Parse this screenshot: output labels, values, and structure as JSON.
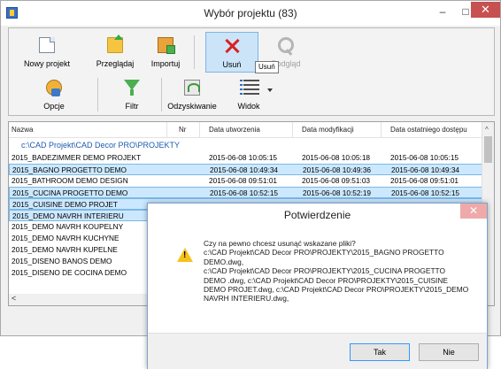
{
  "window": {
    "title": "Wybór projektu (83)",
    "minimize": "–",
    "maximize": "□",
    "close": "✕"
  },
  "toolbar": {
    "new_project": "Nowy projekt",
    "browse": "Przeglądaj",
    "import": "Importuj",
    "delete": "Usuń",
    "preview": "Podgląd",
    "options": "Opcje",
    "filter": "Filtr",
    "recovery": "Odzyskiwanie",
    "view": "Widok",
    "tooltip": "Usuń"
  },
  "list": {
    "columns": [
      "Nazwa",
      "Nr",
      "Data utworzenia",
      "Data modyfikacji",
      "Data ostatniego dostępu"
    ],
    "group_path": "c:\\CAD Projekt\\CAD Decor PRO\\PROJEKTY",
    "rows": [
      {
        "name": "2015_BADEZIMMER DEMO PROJEKT",
        "created": "2015-06-08 10:05:15",
        "modified": "2015-06-08 10:05:18",
        "accessed": "2015-06-08 10:05:15",
        "selected": false
      },
      {
        "name": "2015_BAGNO PROGETTO DEMO",
        "created": "2015-06-08 10:49:34",
        "modified": "2015-06-08 10:49:36",
        "accessed": "2015-06-08 10:49:34",
        "selected": true
      },
      {
        "name": "2015_BATHROOM DEMO DESIGN",
        "created": "2015-06-08 09:51:01",
        "modified": "2015-06-08 09:51:03",
        "accessed": "2015-06-08 09:51:01",
        "selected": false
      },
      {
        "name": "2015_CUCINA PROGETTO DEMO",
        "created": "2015-06-08 10:52:15",
        "modified": "2015-06-08 10:52:19",
        "accessed": "2015-06-08 10:52:15",
        "selected": true
      },
      {
        "name": "2015_CUISINE DEMO PROJET",
        "created": "",
        "modified": "",
        "accessed": "",
        "selected": true
      },
      {
        "name": "2015_DEMO NAVRH INTERIERU",
        "created": "",
        "modified": "",
        "accessed": "",
        "selected": true
      },
      {
        "name": "2015_DEMO NAVRH KOUPELNY",
        "created": "",
        "modified": "",
        "accessed": "",
        "selected": false
      },
      {
        "name": "2015_DEMO NAVRH KUCHYNE",
        "created": "",
        "modified": "",
        "accessed": "",
        "selected": false
      },
      {
        "name": "2015_DEMO NAVRH KUPELNE",
        "created": "",
        "modified": "",
        "accessed": "",
        "selected": false
      },
      {
        "name": "2015_DISENO BANOS DEMO",
        "created": "",
        "modified": "",
        "accessed": "",
        "selected": false
      },
      {
        "name": "2015_DISENO DE COCINA DEMO",
        "created": "",
        "modified": "",
        "accessed": "",
        "selected": false
      }
    ],
    "scroll_left": "<",
    "scroll_up": "^"
  },
  "dialog": {
    "title": "Potwierdzenie",
    "close": "✕",
    "message": "Czy na pewno chcesz usunąć wskazane pliki?\nc:\\CAD Projekt\\CAD Decor PRO\\PROJEKTY\\2015_BAGNO PROGETTO DEMO.dwg,\nc:\\CAD Projekt\\CAD Decor PRO\\PROJEKTY\\2015_CUCINA PROGETTO DEMO .dwg, c:\\CAD Projekt\\CAD Decor PRO\\PROJEKTY\\2015_CUISINE DEMO PROJET.dwg, c:\\CAD Projekt\\CAD Decor PRO\\PROJEKTY\\2015_DEMO NAVRH INTERIERU.dwg,",
    "yes": "Tak",
    "no": "Nie"
  }
}
